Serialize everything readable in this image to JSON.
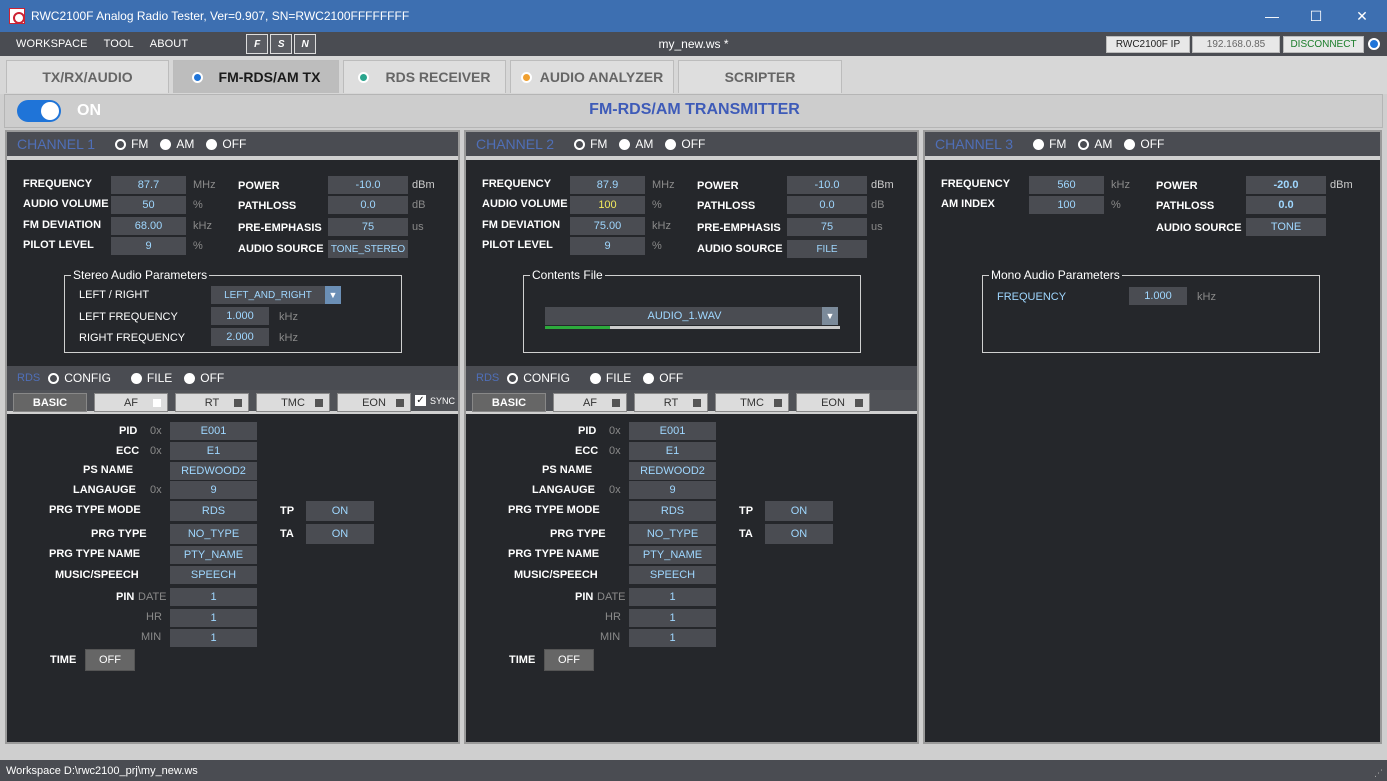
{
  "window": {
    "title": "RWC2100F Analog Radio Tester, Ver=0.907, SN=RWC2100FFFFFFFF",
    "minimize": "—",
    "maximize": "☐",
    "close": "✕"
  },
  "menu": {
    "items": [
      "WORKSPACE",
      "TOOL",
      "ABOUT"
    ],
    "tool_icons": [
      "F",
      "S",
      "N"
    ],
    "workspace_name": "my_new.ws *",
    "ip_label": "RWC2100F IP",
    "ip_value": "192.168.0.85",
    "disconnect": "DISCONNECT"
  },
  "tabs": [
    {
      "label": "TX/RX/AUDIO"
    },
    {
      "label": "FM-RDS/AM TX",
      "dot": "#1f74d8"
    },
    {
      "label": "RDS RECEIVER",
      "dot": "#2aa58d"
    },
    {
      "label": "AUDIO ANALYZER",
      "dot": "#f0a030"
    },
    {
      "label": "SCRIPTER"
    }
  ],
  "header": {
    "toggle_label": "ON",
    "title": "FM-RDS/AM TRANSMITTER"
  },
  "ch1": {
    "name": "CHANNEL 1",
    "modes": [
      "FM",
      "AM",
      "OFF"
    ],
    "frequency_label": "FREQUENCY",
    "frequency": "87.7",
    "frequency_unit": "MHz",
    "volume_label": "AUDIO VOLUME",
    "volume": "50",
    "volume_unit": "%",
    "deviation_label": "FM DEVIATION",
    "deviation": "68.00",
    "deviation_unit": "kHz",
    "pilot_label": "PILOT LEVEL",
    "pilot": "9",
    "pilot_unit": "%",
    "power_label": "POWER",
    "power": "-10.0",
    "power_unit": "dBm",
    "pathloss_label": "PATHLOSS",
    "pathloss": "0.0",
    "pathloss_unit": "dB",
    "preemph_label": "PRE-EMPHASIS",
    "preemph": "75",
    "preemph_unit": "us",
    "source_label": "AUDIO SOURCE",
    "source": "TONE_STEREO",
    "stereo": {
      "title": "Stereo Audio Parameters",
      "lr_label": "LEFT / RIGHT",
      "lr_value": "LEFT_AND_RIGHT",
      "left_label": "LEFT FREQUENCY",
      "left_value": "1.000",
      "left_unit": "kHz",
      "right_label": "RIGHT FREQUENCY",
      "right_value": "2.000",
      "right_unit": "kHz"
    },
    "rds": {
      "label": "RDS",
      "modes": [
        "CONFIG",
        "FILE",
        "OFF"
      ],
      "subtabs": [
        "BASIC",
        "AF",
        "RT",
        "TMC",
        "EON"
      ],
      "sync": "SYNC",
      "pid_label": "PID",
      "pid_prefix": "0x",
      "pid": "E001",
      "ecc_label": "ECC",
      "ecc_prefix": "0x",
      "ecc": "E1",
      "ps_label": "PS NAME",
      "ps": "REDWOOD2",
      "lang_label": "LANGAUGE",
      "lang_prefix": "0x",
      "lang": "9",
      "ptm_label": "PRG TYPE MODE",
      "ptm": "RDS",
      "pt_label": "PRG TYPE",
      "pt": "NO_TYPE",
      "ptn_label": "PRG TYPE NAME",
      "ptn": "PTY_NAME",
      "ms_label": "MUSIC/SPEECH",
      "ms": "SPEECH",
      "pin_label": "PIN",
      "pin_date_label": "DATE",
      "pin_date": "1",
      "pin_hr_label": "HR",
      "pin_hr": "1",
      "pin_min_label": "MIN",
      "pin_min": "1",
      "tp_label": "TP",
      "tp": "ON",
      "ta_label": "TA",
      "ta": "ON",
      "time_label": "TIME",
      "time": "OFF"
    }
  },
  "ch2": {
    "name": "CHANNEL 2",
    "modes": [
      "FM",
      "AM",
      "OFF"
    ],
    "frequency_label": "FREQUENCY",
    "frequency": "87.9",
    "frequency_unit": "MHz",
    "volume_label": "AUDIO VOLUME",
    "volume": "100",
    "volume_unit": "%",
    "deviation_label": "FM DEVIATION",
    "deviation": "75.00",
    "deviation_unit": "kHz",
    "pilot_label": "PILOT LEVEL",
    "pilot": "9",
    "pilot_unit": "%",
    "power_label": "POWER",
    "power": "-10.0",
    "power_unit": "dBm",
    "pathloss_label": "PATHLOSS",
    "pathloss": "0.0",
    "pathloss_unit": "dB",
    "preemph_label": "PRE-EMPHASIS",
    "preemph": "75",
    "preemph_unit": "us",
    "source_label": "AUDIO SOURCE",
    "source": "FILE",
    "contents": {
      "title": "Contents File",
      "file": "AUDIO_1.WAV",
      "progress": 0.22
    },
    "rds": {
      "label": "RDS",
      "modes": [
        "CONFIG",
        "FILE",
        "OFF"
      ],
      "subtabs": [
        "BASIC",
        "AF",
        "RT",
        "TMC",
        "EON"
      ],
      "pid_label": "PID",
      "pid_prefix": "0x",
      "pid": "E001",
      "ecc_label": "ECC",
      "ecc_prefix": "0x",
      "ecc": "E1",
      "ps_label": "PS NAME",
      "ps": "REDWOOD2",
      "lang_label": "LANGAUGE",
      "lang_prefix": "0x",
      "lang": "9",
      "ptm_label": "PRG TYPE MODE",
      "ptm": "RDS",
      "pt_label": "PRG TYPE",
      "pt": "NO_TYPE",
      "ptn_label": "PRG TYPE NAME",
      "ptn": "PTY_NAME",
      "ms_label": "MUSIC/SPEECH",
      "ms": "SPEECH",
      "pin_label": "PIN",
      "pin_date_label": "DATE",
      "pin_date": "1",
      "pin_hr_label": "HR",
      "pin_hr": "1",
      "pin_min_label": "MIN",
      "pin_min": "1",
      "tp_label": "TP",
      "tp": "ON",
      "ta_label": "TA",
      "ta": "ON",
      "time_label": "TIME",
      "time": "OFF"
    }
  },
  "ch3": {
    "name": "CHANNEL 3",
    "modes": [
      "FM",
      "AM",
      "OFF"
    ],
    "frequency_label": "FREQUENCY",
    "frequency": "560",
    "frequency_unit": "kHz",
    "amindex_label": "AM INDEX",
    "amindex": "100",
    "amindex_unit": "%",
    "power_label": "POWER",
    "power": "-20.0",
    "power_unit": "dBm",
    "pathloss_label": "PATHLOSS",
    "pathloss": "0.0",
    "source_label": "AUDIO SOURCE",
    "source": "TONE",
    "mono": {
      "title": "Mono Audio Parameters",
      "freq_label": "FREQUENCY",
      "freq": "1.000",
      "freq_unit": "kHz"
    }
  },
  "status": {
    "text": "Workspace  D:\\rwc2100_prj\\my_new.ws"
  }
}
